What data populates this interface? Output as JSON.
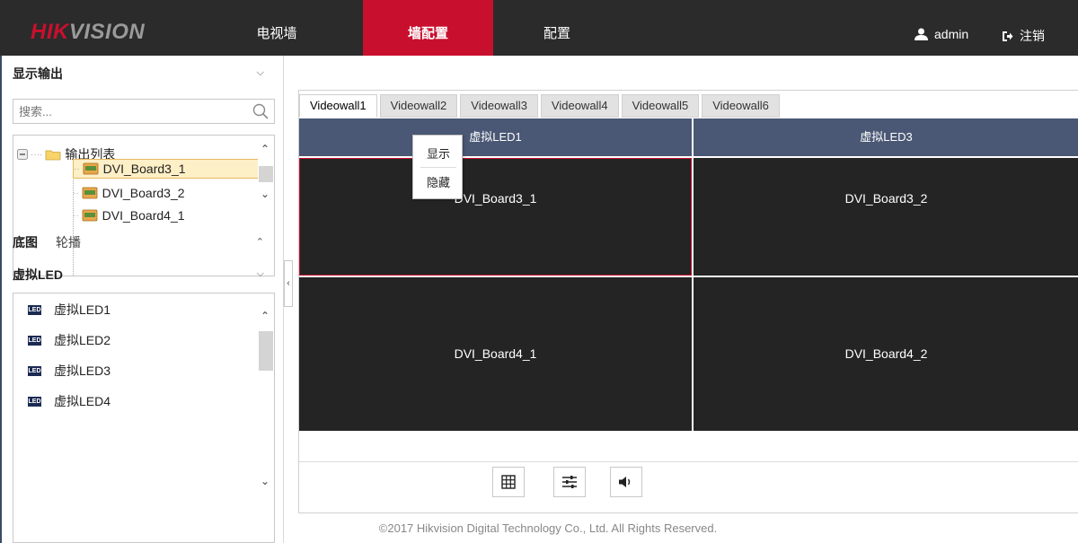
{
  "header": {
    "logo_brand": "HIK",
    "logo_rest": "VISION",
    "nav": [
      "电视墙",
      "墙配置",
      "配置"
    ],
    "active_nav": "墙配置",
    "username": "admin",
    "logout_label": "注销"
  },
  "sidebar": {
    "display_output": {
      "title": "显示输出",
      "search_placeholder": "搜索...",
      "tree_root": "输出列表",
      "tree_items": [
        "DVI_Board3_1",
        "DVI_Board3_2",
        "DVI_Board4_1"
      ],
      "selected_item": "DVI_Board3_1"
    },
    "tabs": [
      "底图",
      "轮播"
    ],
    "virtual_led": {
      "title": "虚拟LED",
      "items": [
        "虚拟LED1",
        "虚拟LED2",
        "虚拟LED3",
        "虚拟LED4"
      ]
    }
  },
  "main": {
    "tabs": [
      "Videowall1",
      "Videowall2",
      "Videowall3",
      "Videowall4",
      "Videowall5",
      "Videowall6"
    ],
    "active_tab": "Videowall1",
    "led_headers": [
      "虚拟LED1",
      "虚拟LED3"
    ],
    "cells": [
      "DVI_Board3_1",
      "DVI_Board3_2",
      "DVI_Board4_1",
      "DVI_Board4_2"
    ],
    "context_menu": [
      "显示",
      "隐藏"
    ],
    "toolbar": [
      "grid-icon",
      "settings-sliders-icon",
      "volume-icon"
    ]
  },
  "footer": {
    "copyright": "©2017 Hikvision Digital Technology Co., Ltd. All Rights Reserved."
  },
  "colors": {
    "topbar": "#2b2b2b",
    "accent": "#c8102e",
    "led_header": "#4a5875",
    "cell_bg": "#242424"
  }
}
